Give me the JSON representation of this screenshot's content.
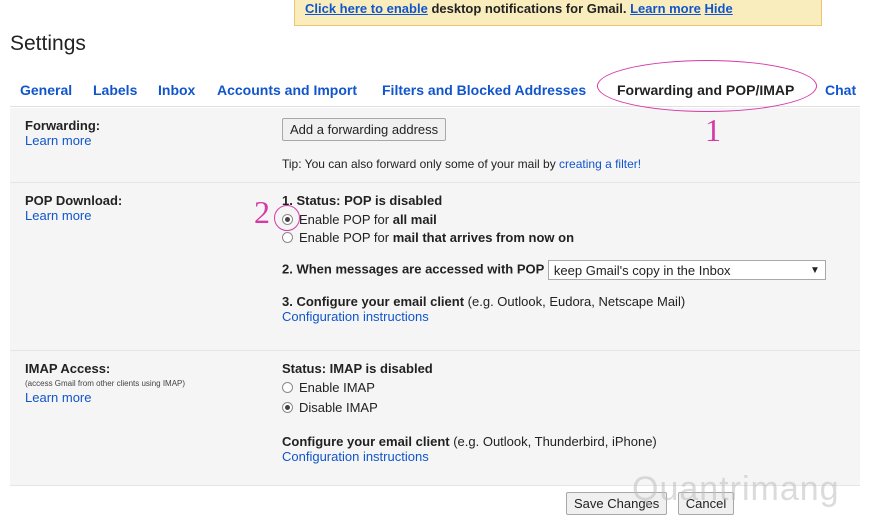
{
  "notification": {
    "link_enable": "Click here to enable",
    "text": "desktop notifications for Gmail.",
    "learn_more": "Learn more",
    "hide": "Hide"
  },
  "title": "Settings",
  "tabs": [
    {
      "label": "General"
    },
    {
      "label": "Labels"
    },
    {
      "label": "Inbox"
    },
    {
      "label": "Accounts and Import"
    },
    {
      "label": "Filters and Blocked Addresses"
    },
    {
      "label": "Forwarding and POP/IMAP"
    },
    {
      "label": "Chat"
    }
  ],
  "forwarding": {
    "label": "Forwarding:",
    "learn_more": "Learn more",
    "add_button": "Add a forwarding address",
    "tip_prefix": "Tip: You can also forward only some of your mail by",
    "tip_link": "creating a filter!"
  },
  "pop": {
    "label": "POP Download:",
    "learn_more": "Learn more",
    "status": "1. Status: POP is disabled",
    "option1_prefix": "Enable POP for",
    "option1_bold": "all mail",
    "option2_prefix": "Enable POP for",
    "option2_bold": "mail that arrives from now on",
    "step2": "2. When messages are accessed with POP",
    "step2_select": "keep Gmail's copy in the Inbox",
    "step3_bold": "3. Configure your email client",
    "step3_rest": "(e.g. Outlook, Eudora, Netscape Mail)",
    "config_link": "Configuration instructions"
  },
  "imap": {
    "label": "IMAP Access:",
    "sublabel": "(access Gmail from other clients using IMAP)",
    "learn_more": "Learn more",
    "status": "Status: IMAP is disabled",
    "enable": "Enable IMAP",
    "disable": "Disable IMAP",
    "configure_bold": "Configure your email client",
    "configure_rest": "(e.g. Outlook, Thunderbird, iPhone)",
    "config_link": "Configuration instructions"
  },
  "buttons": {
    "save": "Save Changes",
    "cancel": "Cancel"
  },
  "annotations": {
    "one": "1",
    "two": "2"
  },
  "watermark": "Quantrimang",
  "colors": {
    "link": "#1155cc",
    "annotation": "#d63aa8",
    "section_bg": "#f5f5f5"
  }
}
